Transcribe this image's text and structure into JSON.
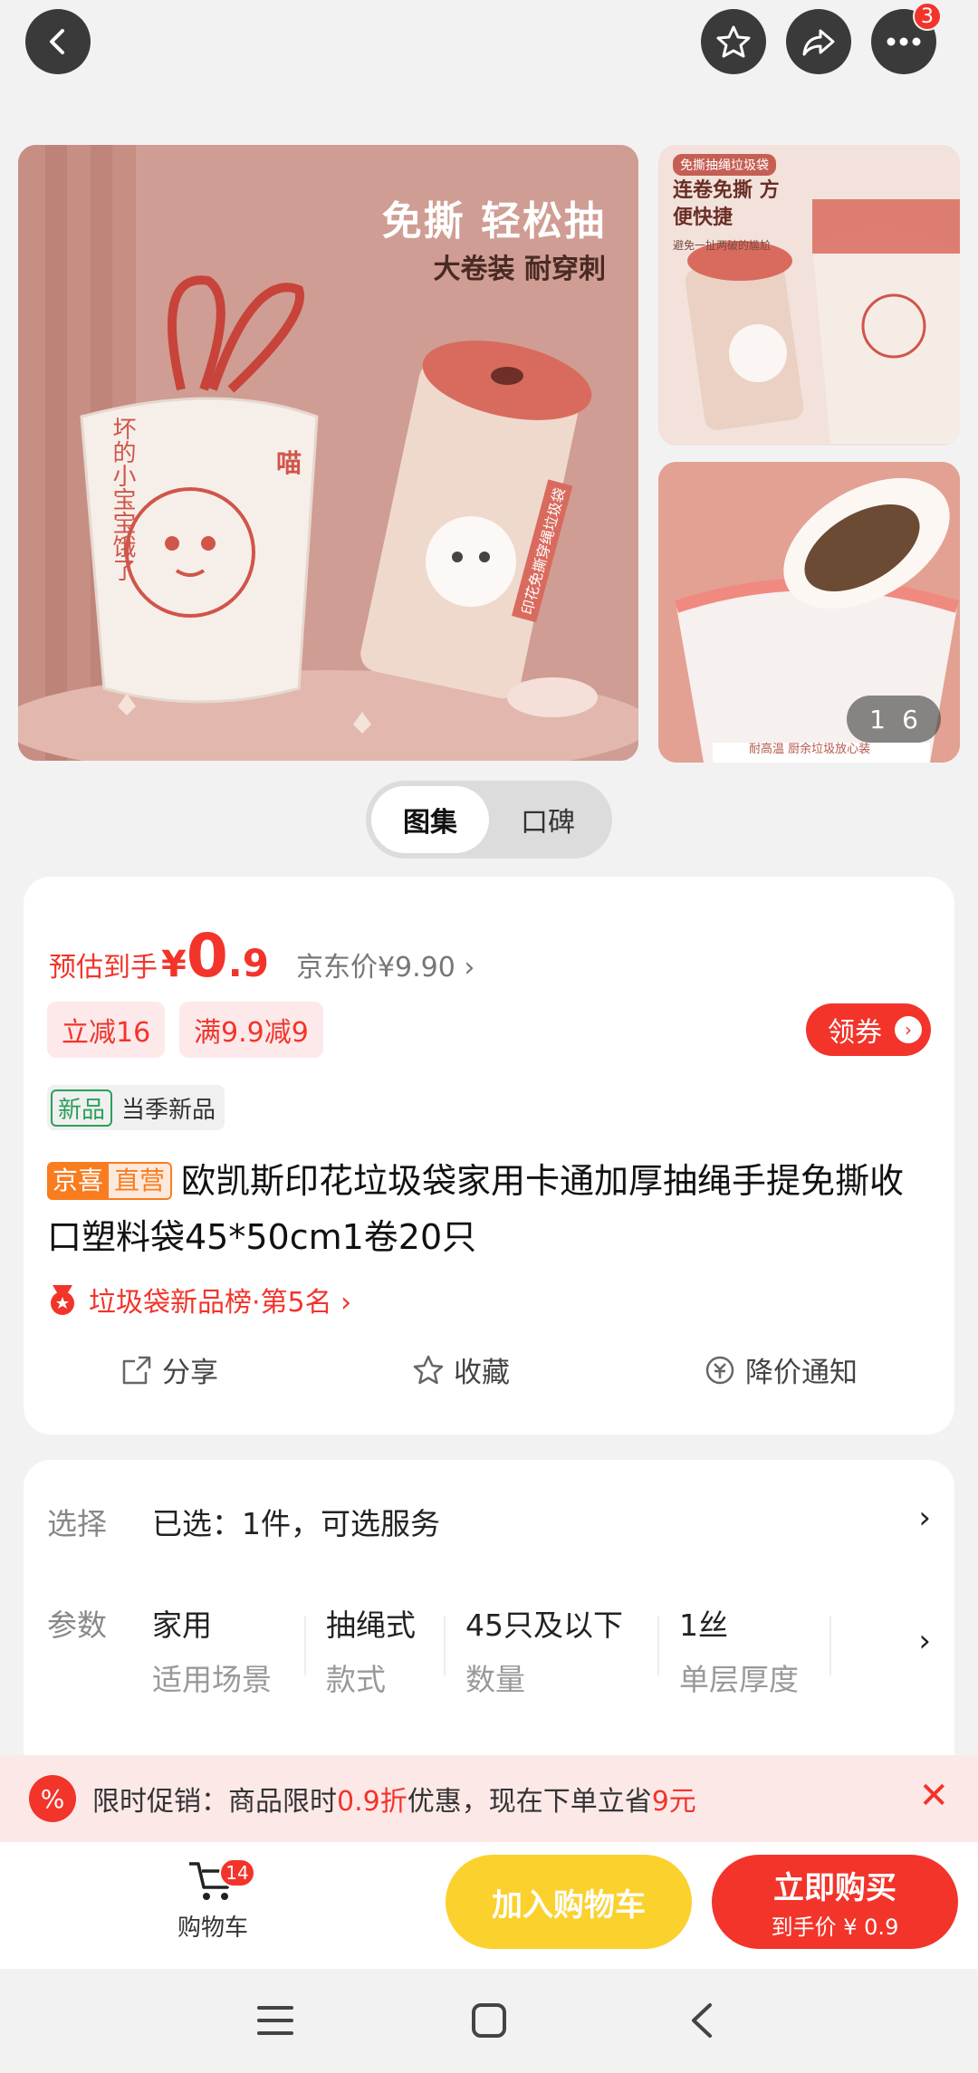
{
  "top_bar": {
    "more_badge": "3"
  },
  "gallery": {
    "main_image": {
      "headline": "免撕 轻松抽",
      "subline": "大卷装 耐穿刺",
      "bag_text": "坏的小宝宝饿了",
      "roll_text": "印花免撕穿绳垃圾袋",
      "meow": "喵"
    },
    "side_top": {
      "tag": "免撕抽绳垃圾袋",
      "headline": "连卷免撕 方便快捷",
      "subline": "避免一扯两破的尴尬"
    },
    "side_bottom": {
      "caption": "耐高温 厨余垃圾放心装"
    },
    "counter_current": "1",
    "counter_total": "6"
  },
  "segment": {
    "tabs": [
      "图集",
      "口碑"
    ],
    "active": 0
  },
  "price": {
    "label": "预估到手",
    "symbol": "¥",
    "integer": "0",
    "decimal": ".9",
    "jd_price": "京东价¥9.90 ›",
    "tags": [
      "立减16",
      "满9.9减9"
    ],
    "coupon_label": "领券",
    "new_tag": "新品",
    "new_text": "当季新品"
  },
  "product": {
    "badge_a": "京喜",
    "badge_b": "直营",
    "title": "欧凯斯印花垃圾袋家用卡通加厚抽绳手提免撕收口塑料袋45*50cm1卷20只",
    "rank": "垃圾袋新品榜·第5名 ›"
  },
  "actions": [
    {
      "label": "分享",
      "icon": "share-icon"
    },
    {
      "label": "收藏",
      "icon": "star-icon"
    },
    {
      "label": "降价通知",
      "icon": "price-drop-icon"
    }
  ],
  "specs": {
    "select_label": "选择",
    "select_value": "已选：1件，可选服务",
    "param_label": "参数",
    "params": [
      {
        "value": "家用",
        "name": "适用场景"
      },
      {
        "value": "抽绳式",
        "name": "款式"
      },
      {
        "value": "45只及以下",
        "name": "数量"
      },
      {
        "value": "1丝",
        "name": "单层厚度"
      }
    ]
  },
  "promo": {
    "prefix": "限时促销：商品限时",
    "discount": "0.9折",
    "middle": "优惠，现在下单立省",
    "save": "9元"
  },
  "bottom": {
    "cart_label": "购物车",
    "cart_count": "14",
    "add_to_cart": "加入购物车",
    "buy_now": "立即购买",
    "buy_sub": "到手价 ¥ 0.9"
  },
  "colors": {
    "accent": "#f2342b",
    "yellow": "#fbd12e",
    "orange": "#f97c1f",
    "green": "#2aa05a"
  }
}
